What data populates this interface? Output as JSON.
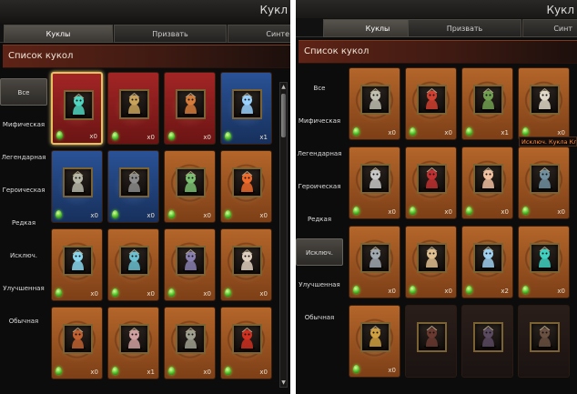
{
  "left_panel": {
    "title": "Кукл",
    "tabs": [
      {
        "label": "Куклы",
        "active": true
      },
      {
        "label": "Призвать",
        "active": false
      },
      {
        "label": "Синте",
        "active": false
      }
    ],
    "section_title": "Список кукол",
    "categories": [
      {
        "label": "Все",
        "active": true
      },
      {
        "label": "Мифическая",
        "active": false
      },
      {
        "label": "Легендарная",
        "active": false
      },
      {
        "label": "Героическая",
        "active": false
      },
      {
        "label": "Редкая",
        "active": false
      },
      {
        "label": "Исключ.",
        "active": false
      },
      {
        "label": "Улучшенная",
        "active": false
      },
      {
        "label": "Обычная",
        "active": false
      }
    ],
    "cards": [
      {
        "count": "x0",
        "rarity": "red",
        "selected": true,
        "icon": "doll-orb-icon",
        "color": "#4fd6c0"
      },
      {
        "count": "x0",
        "rarity": "red",
        "selected": false,
        "icon": "doll-warrior-icon",
        "color": "#c9a35a"
      },
      {
        "count": "x0",
        "rarity": "red",
        "selected": false,
        "icon": "doll-armored-icon",
        "color": "#d67b3a"
      },
      {
        "count": "x1",
        "rarity": "blue",
        "selected": false,
        "icon": "doll-crystal-icon",
        "color": "#9ad2ff"
      },
      {
        "count": "x0",
        "rarity": "blue",
        "selected": false,
        "icon": "doll-knight-icon",
        "color": "#b8b8a8"
      },
      {
        "count": "x0",
        "rarity": "blue",
        "selected": false,
        "icon": "doll-robot-icon",
        "color": "#8c8c8c"
      },
      {
        "count": "x0",
        "rarity": "orange",
        "selected": false,
        "icon": "doll-frog-icon",
        "color": "#7ac070"
      },
      {
        "count": "x0",
        "rarity": "orange",
        "selected": false,
        "icon": "doll-fire-icon",
        "color": "#f06a2a"
      },
      {
        "count": "x0",
        "rarity": "orange",
        "selected": false,
        "icon": "doll-ice-icon",
        "color": "#8ad8f0"
      },
      {
        "count": "x0",
        "rarity": "orange",
        "selected": false,
        "icon": "doll-elf-icon",
        "color": "#6ac0d0"
      },
      {
        "count": "x0",
        "rarity": "orange",
        "selected": false,
        "icon": "doll-golem-icon",
        "color": "#8a80b0"
      },
      {
        "count": "x0",
        "rarity": "orange",
        "selected": false,
        "icon": "doll-girl-icon",
        "color": "#e0d0c0"
      },
      {
        "count": "x0",
        "rarity": "orange",
        "selected": false,
        "icon": "doll-witch-icon",
        "color": "#c06030"
      },
      {
        "count": "x1",
        "rarity": "orange",
        "selected": false,
        "icon": "doll-dwarf-icon",
        "color": "#d0a0a0"
      },
      {
        "count": "x0",
        "rarity": "orange",
        "selected": false,
        "icon": "doll-soldier-icon",
        "color": "#a0a090"
      },
      {
        "count": "x0",
        "rarity": "orange",
        "selected": false,
        "icon": "doll-demon-icon",
        "color": "#d03020"
      }
    ]
  },
  "right_panel": {
    "title": "Кукл",
    "tabs": [
      {
        "label": "Куклы",
        "active": true
      },
      {
        "label": "Призвать",
        "active": false
      },
      {
        "label": "Синт",
        "active": false
      }
    ],
    "section_title": "Список кукол",
    "categories": [
      {
        "label": "Все",
        "active": false
      },
      {
        "label": "Мифическая",
        "active": false
      },
      {
        "label": "Легендарная",
        "active": false
      },
      {
        "label": "Героическая",
        "active": false
      },
      {
        "label": "Редкая",
        "active": false
      },
      {
        "label": "Исключ.",
        "active": true
      },
      {
        "label": "Улучшенная",
        "active": false
      },
      {
        "label": "Обычная",
        "active": false
      }
    ],
    "tooltip": "Исключ. Кукла Клан",
    "cards": [
      {
        "count": "x0",
        "rarity": "orange",
        "icon": "doll-knight-icon",
        "color": "#c0c0b0"
      },
      {
        "count": "x0",
        "rarity": "orange",
        "icon": "doll-demon-icon",
        "color": "#d04030"
      },
      {
        "count": "x1",
        "rarity": "orange",
        "icon": "doll-goblin-icon",
        "color": "#70a050"
      },
      {
        "count": "x0",
        "rarity": "orange",
        "icon": "doll-sage-icon",
        "color": "#e0d8c8"
      },
      {
        "count": "x0",
        "rarity": "orange",
        "icon": "doll-skull-icon",
        "color": "#c8c8c8"
      },
      {
        "count": "x0",
        "rarity": "orange",
        "icon": "doll-vampire-icon",
        "color": "#c03030"
      },
      {
        "count": "x0",
        "rarity": "orange",
        "icon": "doll-elf-icon",
        "color": "#f0c0a0"
      },
      {
        "count": "x0",
        "rarity": "orange",
        "icon": "doll-shadow-icon",
        "color": "#7090a0"
      },
      {
        "count": "x0",
        "rarity": "orange",
        "icon": "doll-armored-icon",
        "color": "#a0a8b0"
      },
      {
        "count": "x0",
        "rarity": "orange",
        "icon": "doll-lion-icon",
        "color": "#e0c090"
      },
      {
        "count": "x2",
        "rarity": "orange",
        "icon": "doll-crystal-icon",
        "color": "#a0d0f0"
      },
      {
        "count": "x0",
        "rarity": "orange",
        "icon": "doll-orb-icon",
        "color": "#40d0c0"
      },
      {
        "count": "x0",
        "rarity": "orange",
        "icon": "doll-samurai-icon",
        "color": "#d0a040"
      },
      {
        "count": "",
        "rarity": "dark",
        "icon": "doll-locked-icon",
        "color": "#6a3a30"
      },
      {
        "count": "",
        "rarity": "dark",
        "icon": "doll-locked-icon",
        "color": "#5a4a60"
      },
      {
        "count": "",
        "rarity": "dark",
        "icon": "doll-locked-icon",
        "color": "#6a5040"
      }
    ]
  }
}
